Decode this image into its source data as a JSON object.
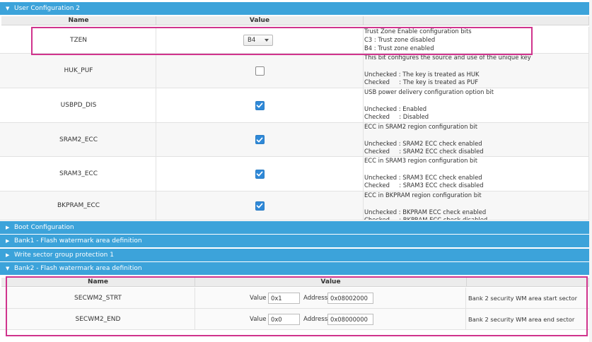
{
  "user_config": {
    "header": "User Configuration 2",
    "col_name": "Name",
    "col_value": "Value",
    "rows": [
      {
        "name": "TZEN",
        "control": "select",
        "value": "B4",
        "desc": [
          "Trust Zone Enable configuration bits",
          "C3 : Trust zone disabled",
          "B4 : Trust zone enabled"
        ]
      },
      {
        "name": "HUK_PUF",
        "control": "checkbox",
        "checked": false,
        "desc": [
          "This bit configures the source and use of the unique key",
          "",
          "Unchecked : The key is treated as HUK",
          "Checked     : The key is treated as PUF"
        ]
      },
      {
        "name": "USBPD_DIS",
        "control": "checkbox",
        "checked": true,
        "desc": [
          "USB power delivery configuration option bit",
          "",
          "Unchecked : Enabled",
          "Checked     : Disabled"
        ]
      },
      {
        "name": "SRAM2_ECC",
        "control": "checkbox",
        "checked": true,
        "desc": [
          "ECC in SRAM2 region configuration bit",
          "",
          "Unchecked : SRAM2 ECC check enabled",
          "Checked     : SRAM2 ECC check disabled"
        ]
      },
      {
        "name": "SRAM3_ECC",
        "control": "checkbox",
        "checked": true,
        "desc": [
          "ECC in SRAM3 region configuration bit",
          "",
          "Unchecked : SRAM3 ECC check enabled",
          "Checked     : SRAM3 ECC check disabled"
        ]
      },
      {
        "name": "BKPRAM_ECC",
        "control": "checkbox",
        "checked": true,
        "desc": [
          "ECC in BKPRAM region configuration bit",
          "",
          "Unchecked : BKPRAM ECC check enabled",
          "Checked     : BKPRAM ECC check disabled"
        ]
      }
    ]
  },
  "sections": [
    {
      "title": "Boot Configuration",
      "expanded": false
    },
    {
      "title": "Bank1 - Flash watermark area definition",
      "expanded": false
    },
    {
      "title": "Write sector group protection 1",
      "expanded": false
    },
    {
      "title": "Bank2 - Flash watermark area definition",
      "expanded": true
    }
  ],
  "bank2": {
    "col_name": "Name",
    "col_value": "Value",
    "value_label": "Value",
    "address_label": "Address",
    "rows": [
      {
        "name": "SECWM2_STRT",
        "value": "0x1",
        "address": "0x08002000",
        "desc": "Bank 2 security WM area start sector"
      },
      {
        "name": "SECWM2_END",
        "value": "0x0",
        "address": "0x08000000",
        "desc": "Bank 2 security WM area end sector"
      }
    ]
  },
  "colors": {
    "header": "#3ca3da",
    "highlight": "#d0348d",
    "checkbox": "#2f89d8"
  },
  "icons": {
    "expanded": "triangle-down-icon",
    "collapsed": "triangle-right-icon",
    "checkmark": "check-icon",
    "caret": "chevron-down-icon"
  }
}
